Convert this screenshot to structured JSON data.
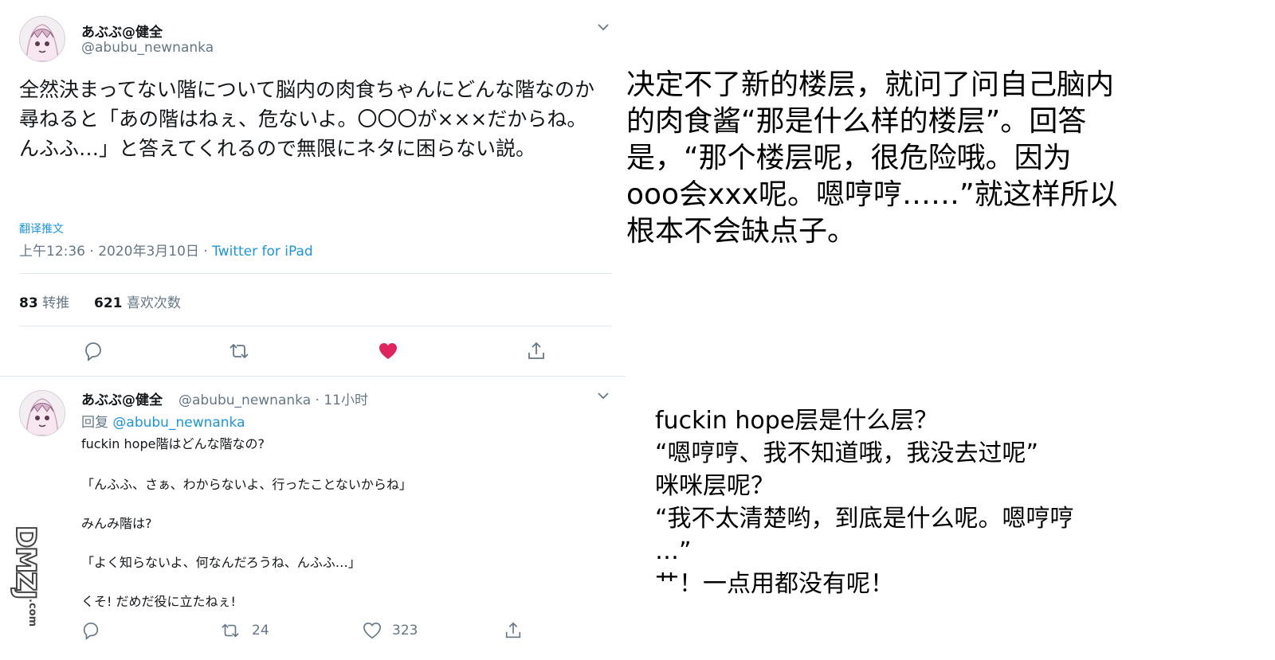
{
  "tweet_main": {
    "display_name": "あぶぶ@健全",
    "handle": "@abubu_newnanka",
    "body": "全然決まってない階について脳内の肉食ちゃんにどんな階なのか尋ねると「あの階はねぇ、危ないよ。〇〇〇が×××だからね。んふふ…」と答えてくれるので無限にネタに困らない説。",
    "translate_label": "翻译推文",
    "time": "上午12:36 · 2020年3月10日 · ",
    "source": "Twitter for iPad",
    "retweet_count": "83",
    "retweet_label": "转推",
    "like_count": "621",
    "like_label": "喜欢次数"
  },
  "tweet_reply": {
    "display_name": "あぶぶ@健全",
    "handle_time": "@abubu_newnanka · 11小时",
    "reply_prefix": "回复 ",
    "reply_mention": "@abubu_newnanka",
    "lines": [
      "fuckin hope階はどんな階なの?",
      "「んふふ、さぁ、わからないよ、行ったことないからね」",
      "みんみ階は?",
      "「よく知らないよ、何なんだろうね、んふふ…」",
      "くそ! だめだ役に立たねぇ!"
    ],
    "retweets": "24",
    "likes": "323"
  },
  "translation_1": "决定不了新的楼层，就问了问自己脑内\n的肉食酱“那是什么样的楼层”。回答\n是，“那个楼层呢，很危险哦。因为\nooo会xxx呢。嗯哼哼……”就这样所以\n根本不会缺点子。",
  "translation_2": "fuckin hope层是什么层？\n“嗯哼哼、我不知道哦，我没去过呢”\n咪咪层呢？\n“我不太清楚哟，到底是什么呢。嗯哼哼\n…”\n艹！一点用都没有呢！",
  "watermark": {
    "text": "DMZJ",
    "suffix": ".com"
  },
  "colors": {
    "link": "#1b95e0",
    "secondary_text": "#657786",
    "like_red": "#e0245e",
    "divider": "#e1e8ed"
  },
  "icons": [
    "chevron-down-icon",
    "reply-icon",
    "retweet-icon",
    "heart-icon",
    "share-icon"
  ]
}
